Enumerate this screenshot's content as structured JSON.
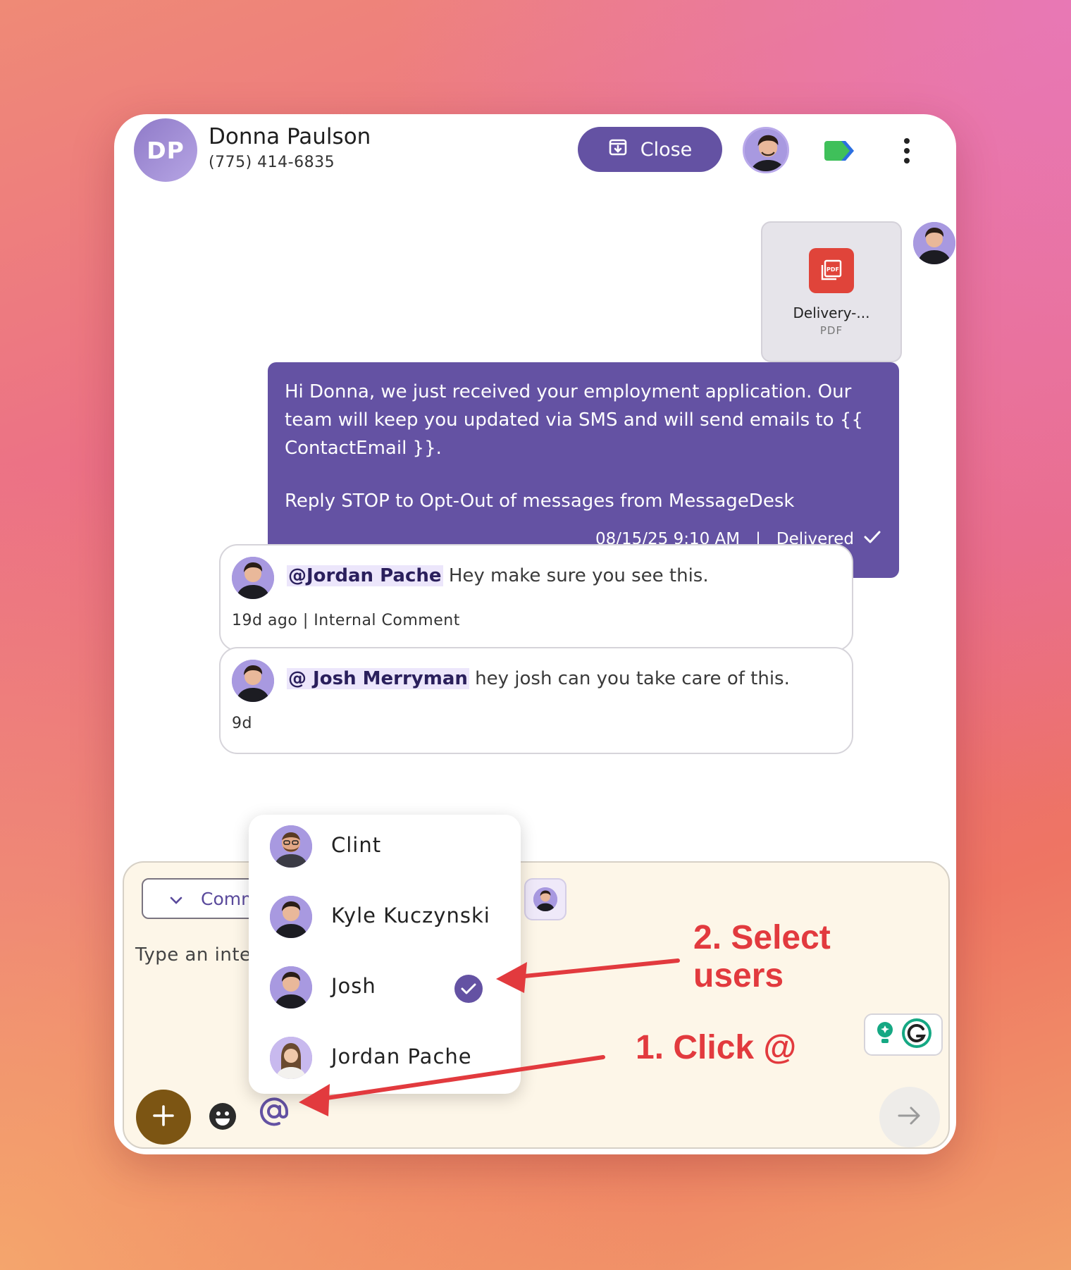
{
  "header": {
    "avatar_initials": "DP",
    "contact_name": "Donna Paulson",
    "contact_phone": "(775) 414-6835",
    "close_label": "Close"
  },
  "attachment": {
    "name": "Delivery-...",
    "type": "PDF",
    "icon_badge": "PDF"
  },
  "message": {
    "text": "Hi Donna, we just received your employment application. Our team will keep you updated via SMS and will send emails to {{ ContactEmail }}.",
    "opt_out": "Reply STOP to Opt-Out of messages from MessageDesk",
    "timestamp": "08/15/25 9:10 AM",
    "separator": "|",
    "status": "Delivered"
  },
  "comments": [
    {
      "mention": "@Jordan Pache",
      "text": "Hey make sure you see this.",
      "meta": "19d ago | Internal Comment"
    },
    {
      "mention": "@ Josh Merryman",
      "text": "hey josh can you take care of this.",
      "meta": "9d"
    }
  ],
  "composer": {
    "mode_label": "Comm",
    "placeholder": "Type an inte"
  },
  "mention_dropdown": [
    {
      "name": "Clint",
      "selected": false
    },
    {
      "name": "Kyle Kuczynski",
      "selected": false
    },
    {
      "name": "Josh",
      "selected": true
    },
    {
      "name": "Jordan Pache",
      "selected": false
    }
  ],
  "annotations": {
    "step2_line1": "2. Select",
    "step2_line2": "users",
    "step1": "1. Click @"
  },
  "colors": {
    "brand_purple": "#6452a3",
    "add_button": "#7c5513",
    "pdf_red": "#e0443a",
    "annotation_red": "#e23a3e",
    "composer_bg": "#fdf6e8"
  }
}
